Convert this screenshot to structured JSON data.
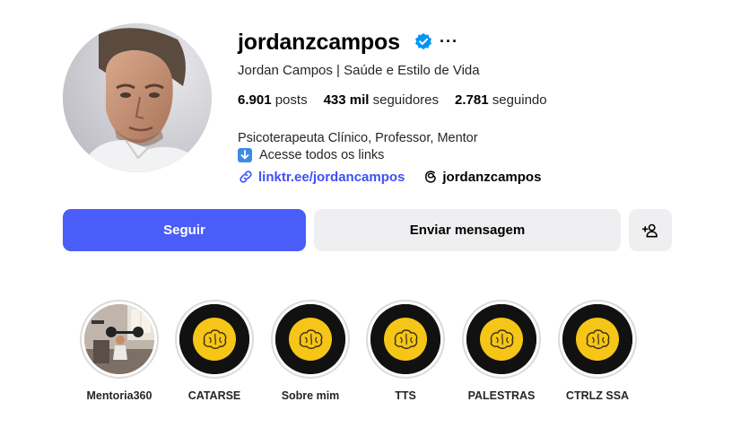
{
  "profile": {
    "username": "jordanzcampos",
    "full_name": "Jordan Campos | Saúde e Estilo de Vida",
    "verified": true,
    "more_icon": "ellipsis-icon"
  },
  "stats": {
    "posts_count": "6.901",
    "posts_label": "posts",
    "followers_count": "433 mil",
    "followers_label": "seguidores",
    "following_count": "2.781",
    "following_label": "seguindo"
  },
  "bio": {
    "line1": "Psicoterapeuta Clínico, Professor, Mentor",
    "line2": "Acesse todos os links",
    "link_text": "linktr.ee/jordancampos",
    "threads_handle": "jordanzcampos"
  },
  "actions": {
    "follow_label": "Seguir",
    "message_label": "Enviar mensagem",
    "add_user_icon": "add-person-icon"
  },
  "highlights": [
    {
      "label": "Mentoria360"
    },
    {
      "label": "CATARSE"
    },
    {
      "label": "Sobre mim"
    },
    {
      "label": "TTS"
    },
    {
      "label": "PALESTRAS"
    },
    {
      "label": "CTRLZ SSA"
    }
  ],
  "colors": {
    "follow_button": "#4a5df9",
    "link": "#4150f7",
    "verified_badge": "#0095f6",
    "highlight_brain": "#f5c518"
  }
}
